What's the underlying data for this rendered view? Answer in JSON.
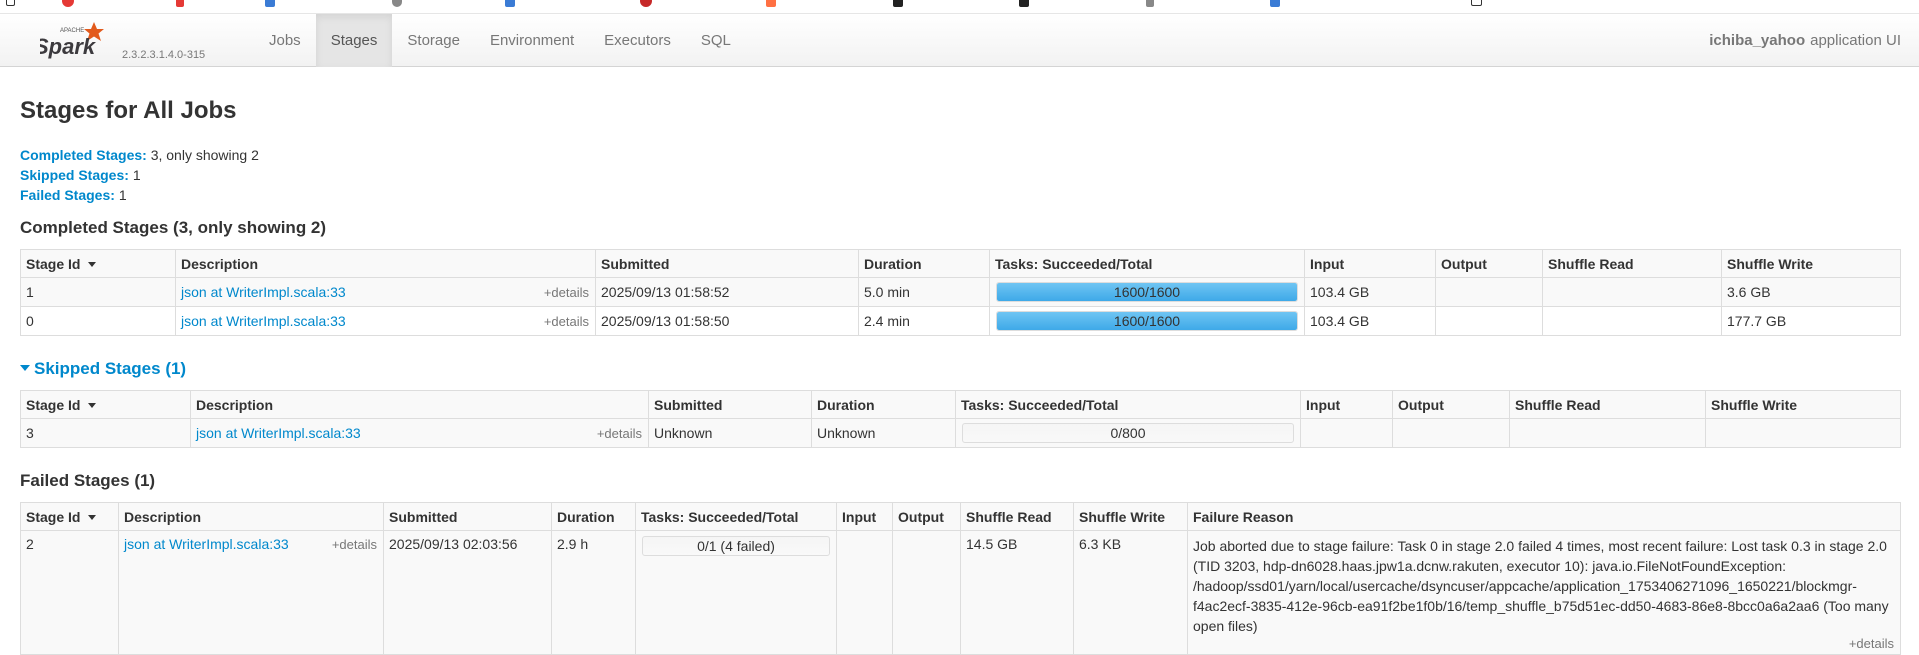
{
  "spark": {
    "brand": "Spark",
    "apache": "APACHE",
    "version": "2.3.2.3.1.4.0-315"
  },
  "nav": {
    "items": [
      {
        "label": "Jobs"
      },
      {
        "label": "Stages"
      },
      {
        "label": "Storage"
      },
      {
        "label": "Environment"
      },
      {
        "label": "Executors"
      },
      {
        "label": "SQL"
      }
    ],
    "active": "Stages"
  },
  "app": {
    "name": "ichiba_yahoo",
    "suffix": "application UI"
  },
  "page_title": "Stages for All Jobs",
  "summary": {
    "completed_label": "Completed Stages:",
    "completed_value": "3, only showing 2",
    "skipped_label": "Skipped Stages:",
    "skipped_value": "1",
    "failed_label": "Failed Stages:",
    "failed_value": "1"
  },
  "completed": {
    "title": "Completed Stages (3, only showing 2)",
    "headers": [
      "Stage Id",
      "Description",
      "Submitted",
      "Duration",
      "Tasks: Succeeded/Total",
      "Input",
      "Output",
      "Shuffle Read",
      "Shuffle Write"
    ],
    "rows": [
      {
        "id": "1",
        "desc": "json at WriterImpl.scala:33",
        "details": "+details",
        "submitted": "2025/09/13 01:58:52",
        "duration": "5.0 min",
        "tasks": "1600/1600",
        "progress": 1.0,
        "input": "103.4 GB",
        "output": "",
        "shuffle_read": "",
        "shuffle_write": "3.6 GB"
      },
      {
        "id": "0",
        "desc": "json at WriterImpl.scala:33",
        "details": "+details",
        "submitted": "2025/09/13 01:58:50",
        "duration": "2.4 min",
        "tasks": "1600/1600",
        "progress": 1.0,
        "input": "103.4 GB",
        "output": "",
        "shuffle_read": "",
        "shuffle_write": "177.7 GB"
      }
    ]
  },
  "skipped": {
    "title": "Skipped Stages (1)",
    "headers": [
      "Stage Id",
      "Description",
      "Submitted",
      "Duration",
      "Tasks: Succeeded/Total",
      "Input",
      "Output",
      "Shuffle Read",
      "Shuffle Write"
    ],
    "rows": [
      {
        "id": "3",
        "desc": "json at WriterImpl.scala:33",
        "details": "+details",
        "submitted": "Unknown",
        "duration": "Unknown",
        "tasks": "0/800",
        "progress": 0.0,
        "input": "",
        "output": "",
        "shuffle_read": "",
        "shuffle_write": ""
      }
    ]
  },
  "failed": {
    "title": "Failed Stages (1)",
    "headers": [
      "Stage Id",
      "Description",
      "Submitted",
      "Duration",
      "Tasks: Succeeded/Total",
      "Input",
      "Output",
      "Shuffle Read",
      "Shuffle Write",
      "Failure Reason"
    ],
    "rows": [
      {
        "id": "2",
        "desc": "json at WriterImpl.scala:33",
        "details": "+details",
        "submitted": "2025/09/13 02:03:56",
        "duration": "2.9 h",
        "tasks": "0/1 (4 failed)",
        "progress": 0.0,
        "input": "",
        "output": "",
        "shuffle_read": "14.5 GB",
        "shuffle_write": "6.3 KB",
        "failure_reason": "Job aborted due to stage failure: Task 0 in stage 2.0 failed 4 times, most recent failure: Lost task 0.3 in stage 2.0 (TID 3203, hdp-dn6028.haas.jpw1a.dcnw.rakuten, executor 10): java.io.FileNotFoundException: /hadoop/ssd01/yarn/local/usercache/dsyncuser/appcache/application_1753406271096_1650221/blockmgr-f4ac2ecf-3835-412e-96cb-ea91f2be1f0b/16/temp_shuffle_b75d51ec-dd50-4683-86e8-8bcc0a6a2aa6 (Too many open files)",
        "failure_details": "+details"
      }
    ]
  },
  "colors": {
    "link": "#0088cc",
    "progress": "#3ea9e8",
    "header_bg": "#f9f9f9"
  }
}
